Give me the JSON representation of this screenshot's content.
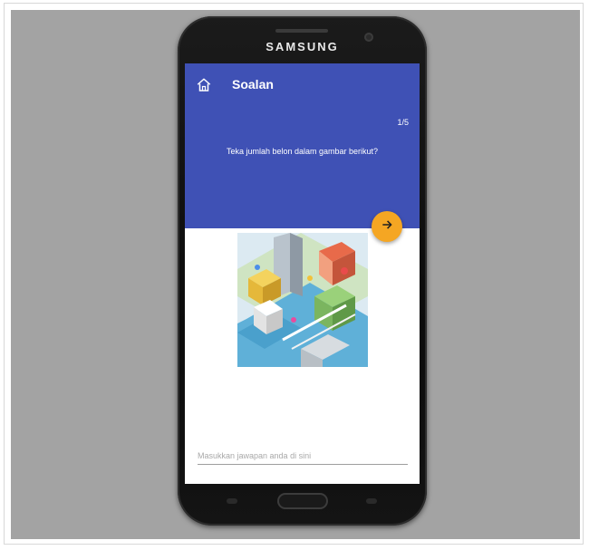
{
  "device": {
    "brand": "SAMSUNG"
  },
  "appbar": {
    "title": "Soalan",
    "home_icon": "home-icon"
  },
  "question": {
    "counter": "1/5",
    "text": "Teka jumlah belon dalam gambar berikut?"
  },
  "fab": {
    "icon": "arrow-right-icon"
  },
  "answer_field": {
    "value": "",
    "placeholder": "Masukkan jawapan anda di sini"
  },
  "colors": {
    "primary": "#3f51b5",
    "accent": "#f5a623",
    "backdrop": "#a3a3a3"
  }
}
